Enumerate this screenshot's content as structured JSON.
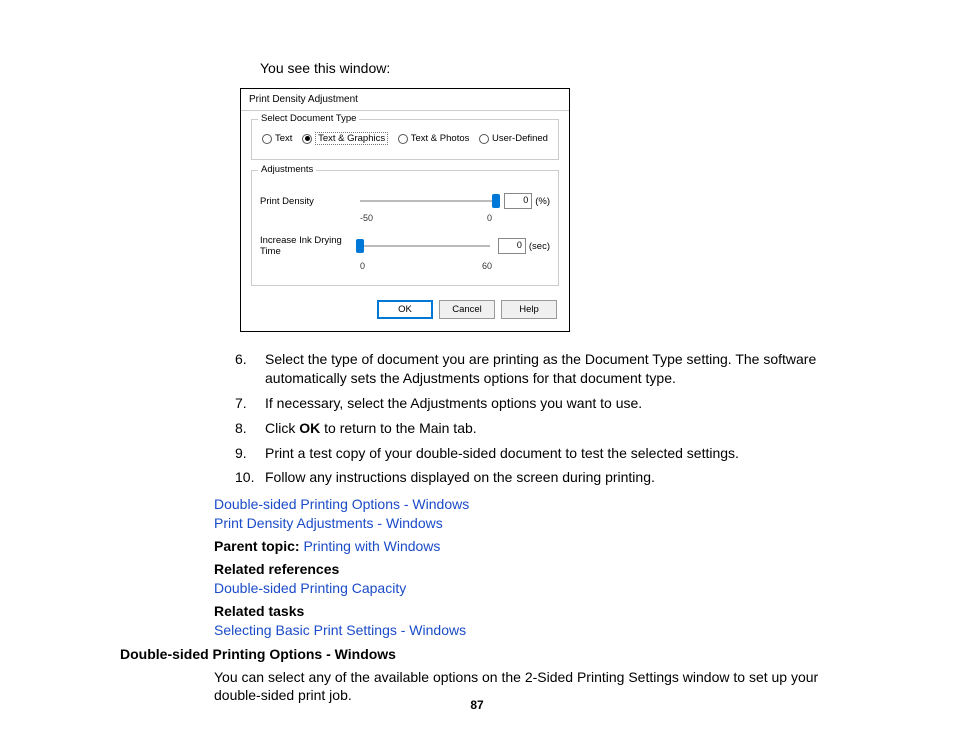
{
  "intro": "You see this window:",
  "dialog": {
    "title": "Print Density Adjustment",
    "group1": {
      "title": "Select Document Type",
      "options": [
        "Text",
        "Text & Graphics",
        "Text & Photos",
        "User-Defined"
      ],
      "selectedIndex": 1
    },
    "group2": {
      "title": "Adjustments",
      "slider1": {
        "label": "Print Density",
        "min": "-50",
        "max": "0",
        "value": "0",
        "unit": "(%)"
      },
      "slider2": {
        "label": "Increase Ink Drying Time",
        "min": "0",
        "max": "60",
        "value": "0",
        "unit": "(sec)"
      }
    },
    "buttons": {
      "ok": "OK",
      "cancel": "Cancel",
      "help": "Help"
    }
  },
  "steps": [
    {
      "num": "6.",
      "text_pre": "Select the type of document you are printing as the Document Type setting. The software automatically sets the Adjustments options for that document type."
    },
    {
      "num": "7.",
      "text_pre": "If necessary, select the Adjustments options you want to use."
    },
    {
      "num": "8.",
      "text_pre": "Click ",
      "bold": "OK",
      "text_post": " to return to the Main tab."
    },
    {
      "num": "9.",
      "text_pre": "Print a test copy of your double-sided document to test the selected settings."
    },
    {
      "num": "10.",
      "text_pre": "Follow any instructions displayed on the screen during printing."
    }
  ],
  "links1": [
    "Double-sided Printing Options - Windows",
    "Print Density Adjustments - Windows"
  ],
  "parentTopic": {
    "label": "Parent topic: ",
    "link": "Printing with Windows"
  },
  "relatedRefs": {
    "heading": "Related references",
    "link": "Double-sided Printing Capacity"
  },
  "relatedTasks": {
    "heading": "Related tasks",
    "link": "Selecting Basic Print Settings - Windows"
  },
  "section2": {
    "heading": "Double-sided Printing Options - Windows",
    "body": "You can select any of the available options on the 2-Sided Printing Settings window to set up your double-sided print job."
  },
  "pageNumber": "87"
}
